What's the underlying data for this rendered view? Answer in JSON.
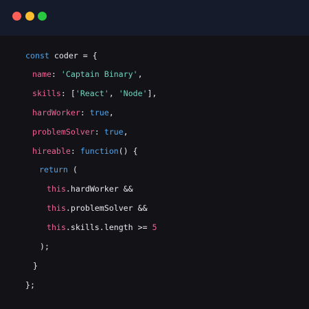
{
  "window": {
    "controls": [
      "close",
      "minimize",
      "maximize"
    ],
    "colors": {
      "close": "#fe5f57",
      "minimize": "#febc2e",
      "maximize": "#28c840",
      "titlebar": "#161b2b",
      "background": "#121217"
    }
  },
  "code": {
    "l1": {
      "kw": "const",
      "rest": " coder = {"
    },
    "l2": {
      "prop": "name",
      "sep": ": ",
      "str": "'Captain Binary'",
      "end": ","
    },
    "l3": {
      "prop": "skills",
      "sep": ": [",
      "s1": "'React'",
      "mid": ", ",
      "s2": "'Node'",
      "end": "],"
    },
    "l4": {
      "prop": "hardWorker",
      "sep": ": ",
      "kw": "true",
      "end": ","
    },
    "l5": {
      "prop": "problemSolver",
      "sep": ": ",
      "kw": "true",
      "end": ","
    },
    "l6": {
      "prop": "hireable",
      "sep": ": ",
      "kw": "function",
      "end": "() {"
    },
    "l7": {
      "kw": "return",
      "end": " ("
    },
    "l8": {
      "this": "this",
      "rest": ".hardWorker &&"
    },
    "l9": {
      "this": "this",
      "rest": ".problemSolver &&"
    },
    "l10": {
      "this": "this",
      "rest": ".skills.length >= ",
      "num": "5"
    },
    "l11": {
      "text": ");"
    },
    "l12": {
      "text": "}"
    },
    "l13": {
      "text": "};"
    }
  }
}
